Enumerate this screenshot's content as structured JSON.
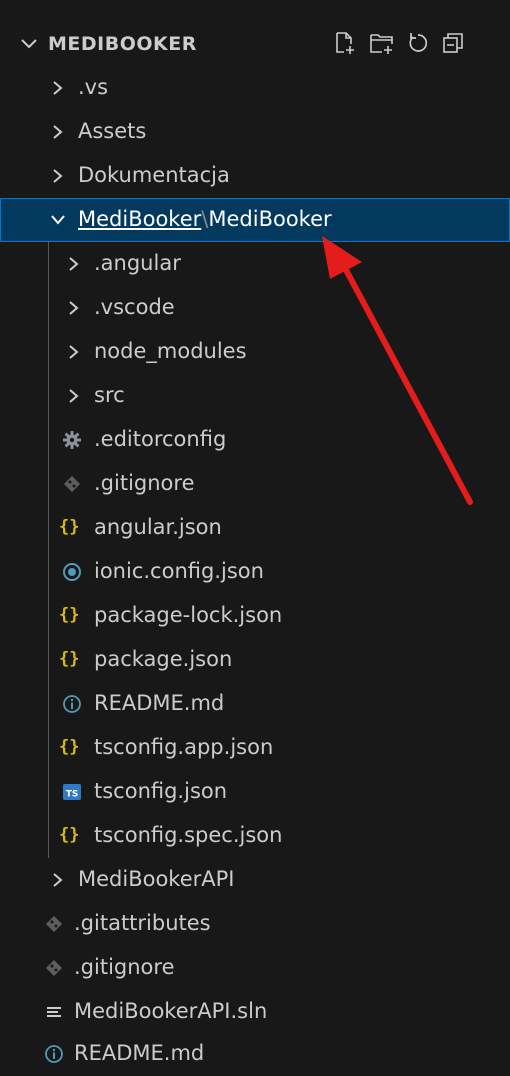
{
  "explorer": {
    "root_title": "MEDIBOOKER",
    "actions": [
      "new-file-icon",
      "new-folder-icon",
      "refresh-icon",
      "collapse-all-icon"
    ]
  },
  "tree": [
    {
      "label": ".vs",
      "type": "folder",
      "expanded": false
    },
    {
      "label": "Assets",
      "type": "folder",
      "expanded": false
    },
    {
      "label": "Dokumentacja",
      "type": "folder",
      "expanded": false
    },
    {
      "label_part1": "MediBooker",
      "separator": "\\",
      "label_part2": "MediBooker",
      "type": "folder",
      "expanded": true,
      "selected": true
    },
    {
      "label": ".angular",
      "type": "folder",
      "expanded": false
    },
    {
      "label": ".vscode",
      "type": "folder",
      "expanded": false
    },
    {
      "label": "node_modules",
      "type": "folder",
      "expanded": false
    },
    {
      "label": "src",
      "type": "folder",
      "expanded": false
    },
    {
      "label": ".editorconfig",
      "type": "file",
      "icon": "gear-icon"
    },
    {
      "label": ".gitignore",
      "type": "file",
      "icon": "git-icon"
    },
    {
      "label": "angular.json",
      "type": "file",
      "icon": "json-braces-icon"
    },
    {
      "label": "ionic.config.json",
      "type": "file",
      "icon": "ionic-icon"
    },
    {
      "label": "package-lock.json",
      "type": "file",
      "icon": "json-braces-icon"
    },
    {
      "label": "package.json",
      "type": "file",
      "icon": "json-braces-icon"
    },
    {
      "label": "README.md",
      "type": "file",
      "icon": "info-icon"
    },
    {
      "label": "tsconfig.app.json",
      "type": "file",
      "icon": "json-braces-icon"
    },
    {
      "label": "tsconfig.json",
      "type": "file",
      "icon": "typescript-icon",
      "icon_text": "TS"
    },
    {
      "label": "tsconfig.spec.json",
      "type": "file",
      "icon": "json-braces-icon"
    },
    {
      "label": "MediBookerAPI",
      "type": "folder",
      "expanded": false
    },
    {
      "label": ".gitattributes",
      "type": "file",
      "icon": "git-icon"
    },
    {
      "label": ".gitignore",
      "type": "file",
      "icon": "git-icon"
    },
    {
      "label": "MediBookerAPI.sln",
      "type": "file",
      "icon": "lines-icon"
    },
    {
      "label": "README.md",
      "type": "file",
      "icon": "info-icon"
    }
  ],
  "colors": {
    "background": "#181818",
    "selection": "#04395e",
    "selection_border": "#0078d4",
    "json_icon": "#d7ba1c",
    "info_icon": "#519aba",
    "ts_icon": "#3178c6",
    "arrow": "#e51c1c"
  }
}
